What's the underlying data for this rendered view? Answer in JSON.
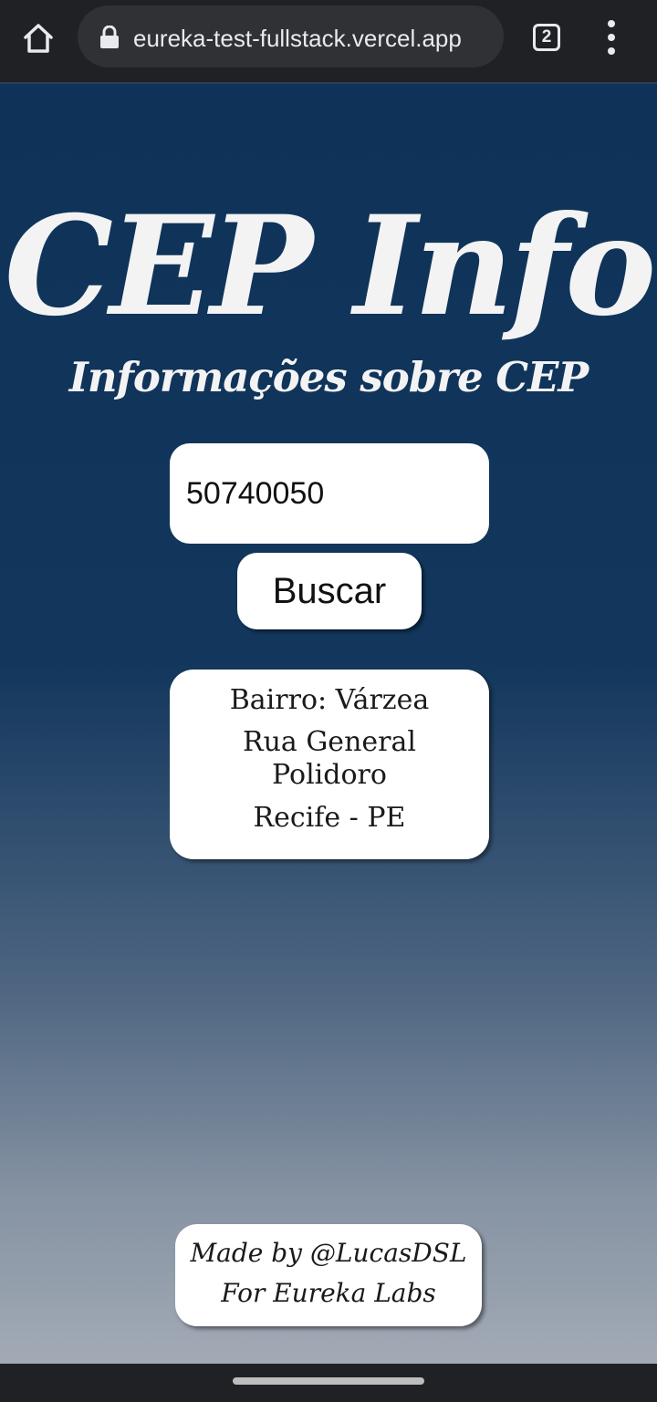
{
  "browser": {
    "url": "eureka-test-fullstack.vercel.app",
    "tab_count": "2",
    "icons": {
      "home": "home-icon",
      "lock": "lock-icon",
      "tabs": "tab-switcher-icon",
      "menu": "more-vert-icon"
    }
  },
  "page": {
    "title": "CEP Info",
    "subtitle": "Informações sobre CEP",
    "cep_value": "50740050",
    "search_label": "Buscar",
    "result": {
      "bairro": "Bairro: Várzea",
      "rua_line1": "Rua General",
      "rua_line2": "Polidoro",
      "cidade": "Recife - PE"
    },
    "footer": {
      "line1": "Made by @LucasDSL",
      "line2": "For Eureka Labs"
    }
  },
  "colors": {
    "background_top": "#0f3358",
    "background_bottom": "#a2aab5",
    "card": "#ffffff",
    "chrome": "#202124"
  }
}
